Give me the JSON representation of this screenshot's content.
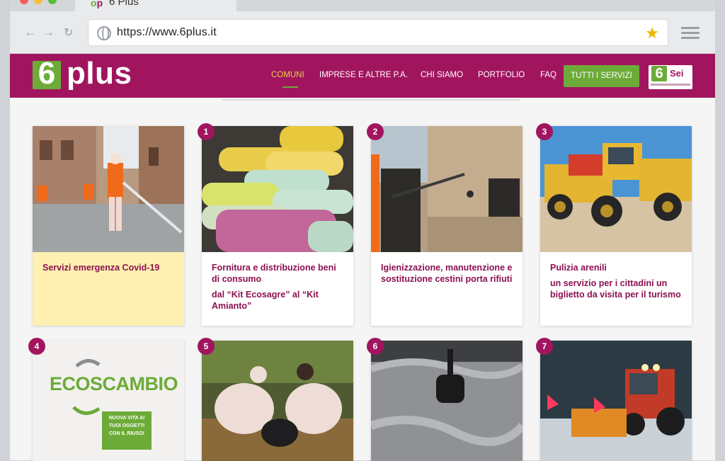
{
  "browser": {
    "tab_title": "6 Plus",
    "url": "https://www.6plus.it"
  },
  "site": {
    "logo_number": "6",
    "logo_word": "plus",
    "nav": [
      {
        "label": "COMUNI",
        "active": true
      },
      {
        "label": "IMPRESE E ALTRE P.A.",
        "active": false
      },
      {
        "label": "CHI SIAMO",
        "active": false
      },
      {
        "label": "PORTFOLIO",
        "active": false
      },
      {
        "label": "FAQ",
        "active": false
      }
    ],
    "cta_label": "TUTTI I SERVIZI",
    "partner_number": "6",
    "partner_label": "Sei"
  },
  "cards": [
    {
      "badge": "",
      "title": "Servizi emergenza Covid-19",
      "subtitle": ""
    },
    {
      "badge": "1",
      "title": "Fornitura e distribuzione beni di consumo",
      "subtitle": "dal “Kit Ecosagre” al “Kit Amianto”"
    },
    {
      "badge": "2",
      "title": "Igienizzazione, manutenzione e sostituzione cestini porta rifiuti",
      "subtitle": ""
    },
    {
      "badge": "3",
      "title": "Pulizia arenili",
      "subtitle": "un servizio per i cittadini un biglietto da visita per il turismo"
    },
    {
      "badge": "4",
      "title": "",
      "subtitle": ""
    },
    {
      "badge": "5",
      "title": "",
      "subtitle": ""
    },
    {
      "badge": "6",
      "title": "",
      "subtitle": ""
    },
    {
      "badge": "7",
      "title": "",
      "subtitle": ""
    }
  ],
  "ecoscambio": {
    "brand": "ECOSCAMBIO",
    "tagline": "NUOVA VITA AI TUOI OGGETTI CON IL RIUSO!"
  },
  "colors": {
    "brand": "#a1155f",
    "green": "#6dab38",
    "highlight": "#fdf0b0"
  }
}
